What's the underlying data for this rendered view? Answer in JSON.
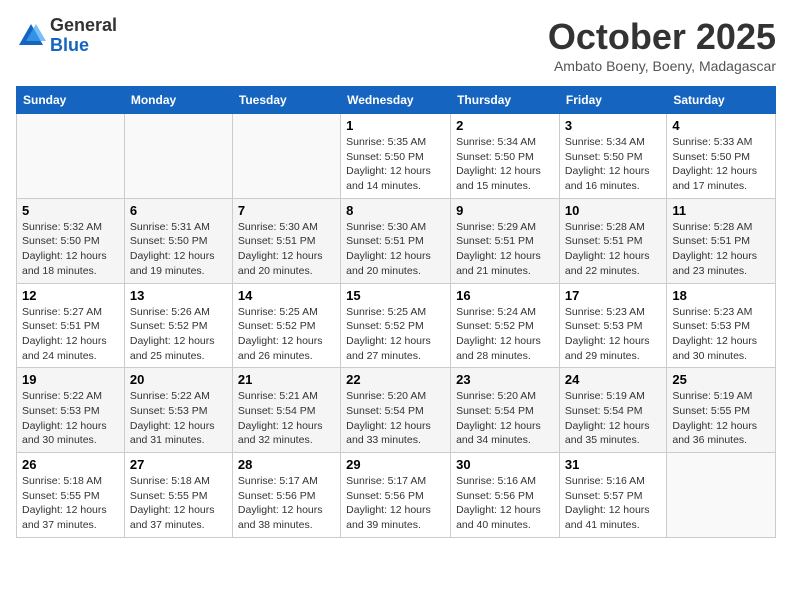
{
  "logo": {
    "general": "General",
    "blue": "Blue"
  },
  "header": {
    "month": "October 2025",
    "location": "Ambato Boeny, Boeny, Madagascar"
  },
  "weekdays": [
    "Sunday",
    "Monday",
    "Tuesday",
    "Wednesday",
    "Thursday",
    "Friday",
    "Saturday"
  ],
  "weeks": [
    [
      {
        "day": "",
        "info": ""
      },
      {
        "day": "",
        "info": ""
      },
      {
        "day": "",
        "info": ""
      },
      {
        "day": "1",
        "info": "Sunrise: 5:35 AM\nSunset: 5:50 PM\nDaylight: 12 hours and 14 minutes."
      },
      {
        "day": "2",
        "info": "Sunrise: 5:34 AM\nSunset: 5:50 PM\nDaylight: 12 hours and 15 minutes."
      },
      {
        "day": "3",
        "info": "Sunrise: 5:34 AM\nSunset: 5:50 PM\nDaylight: 12 hours and 16 minutes."
      },
      {
        "day": "4",
        "info": "Sunrise: 5:33 AM\nSunset: 5:50 PM\nDaylight: 12 hours and 17 minutes."
      }
    ],
    [
      {
        "day": "5",
        "info": "Sunrise: 5:32 AM\nSunset: 5:50 PM\nDaylight: 12 hours and 18 minutes."
      },
      {
        "day": "6",
        "info": "Sunrise: 5:31 AM\nSunset: 5:50 PM\nDaylight: 12 hours and 19 minutes."
      },
      {
        "day": "7",
        "info": "Sunrise: 5:30 AM\nSunset: 5:51 PM\nDaylight: 12 hours and 20 minutes."
      },
      {
        "day": "8",
        "info": "Sunrise: 5:30 AM\nSunset: 5:51 PM\nDaylight: 12 hours and 20 minutes."
      },
      {
        "day": "9",
        "info": "Sunrise: 5:29 AM\nSunset: 5:51 PM\nDaylight: 12 hours and 21 minutes."
      },
      {
        "day": "10",
        "info": "Sunrise: 5:28 AM\nSunset: 5:51 PM\nDaylight: 12 hours and 22 minutes."
      },
      {
        "day": "11",
        "info": "Sunrise: 5:28 AM\nSunset: 5:51 PM\nDaylight: 12 hours and 23 minutes."
      }
    ],
    [
      {
        "day": "12",
        "info": "Sunrise: 5:27 AM\nSunset: 5:51 PM\nDaylight: 12 hours and 24 minutes."
      },
      {
        "day": "13",
        "info": "Sunrise: 5:26 AM\nSunset: 5:52 PM\nDaylight: 12 hours and 25 minutes."
      },
      {
        "day": "14",
        "info": "Sunrise: 5:25 AM\nSunset: 5:52 PM\nDaylight: 12 hours and 26 minutes."
      },
      {
        "day": "15",
        "info": "Sunrise: 5:25 AM\nSunset: 5:52 PM\nDaylight: 12 hours and 27 minutes."
      },
      {
        "day": "16",
        "info": "Sunrise: 5:24 AM\nSunset: 5:52 PM\nDaylight: 12 hours and 28 minutes."
      },
      {
        "day": "17",
        "info": "Sunrise: 5:23 AM\nSunset: 5:53 PM\nDaylight: 12 hours and 29 minutes."
      },
      {
        "day": "18",
        "info": "Sunrise: 5:23 AM\nSunset: 5:53 PM\nDaylight: 12 hours and 30 minutes."
      }
    ],
    [
      {
        "day": "19",
        "info": "Sunrise: 5:22 AM\nSunset: 5:53 PM\nDaylight: 12 hours and 30 minutes."
      },
      {
        "day": "20",
        "info": "Sunrise: 5:22 AM\nSunset: 5:53 PM\nDaylight: 12 hours and 31 minutes."
      },
      {
        "day": "21",
        "info": "Sunrise: 5:21 AM\nSunset: 5:54 PM\nDaylight: 12 hours and 32 minutes."
      },
      {
        "day": "22",
        "info": "Sunrise: 5:20 AM\nSunset: 5:54 PM\nDaylight: 12 hours and 33 minutes."
      },
      {
        "day": "23",
        "info": "Sunrise: 5:20 AM\nSunset: 5:54 PM\nDaylight: 12 hours and 34 minutes."
      },
      {
        "day": "24",
        "info": "Sunrise: 5:19 AM\nSunset: 5:54 PM\nDaylight: 12 hours and 35 minutes."
      },
      {
        "day": "25",
        "info": "Sunrise: 5:19 AM\nSunset: 5:55 PM\nDaylight: 12 hours and 36 minutes."
      }
    ],
    [
      {
        "day": "26",
        "info": "Sunrise: 5:18 AM\nSunset: 5:55 PM\nDaylight: 12 hours and 37 minutes."
      },
      {
        "day": "27",
        "info": "Sunrise: 5:18 AM\nSunset: 5:55 PM\nDaylight: 12 hours and 37 minutes."
      },
      {
        "day": "28",
        "info": "Sunrise: 5:17 AM\nSunset: 5:56 PM\nDaylight: 12 hours and 38 minutes."
      },
      {
        "day": "29",
        "info": "Sunrise: 5:17 AM\nSunset: 5:56 PM\nDaylight: 12 hours and 39 minutes."
      },
      {
        "day": "30",
        "info": "Sunrise: 5:16 AM\nSunset: 5:56 PM\nDaylight: 12 hours and 40 minutes."
      },
      {
        "day": "31",
        "info": "Sunrise: 5:16 AM\nSunset: 5:57 PM\nDaylight: 12 hours and 41 minutes."
      },
      {
        "day": "",
        "info": ""
      }
    ]
  ]
}
